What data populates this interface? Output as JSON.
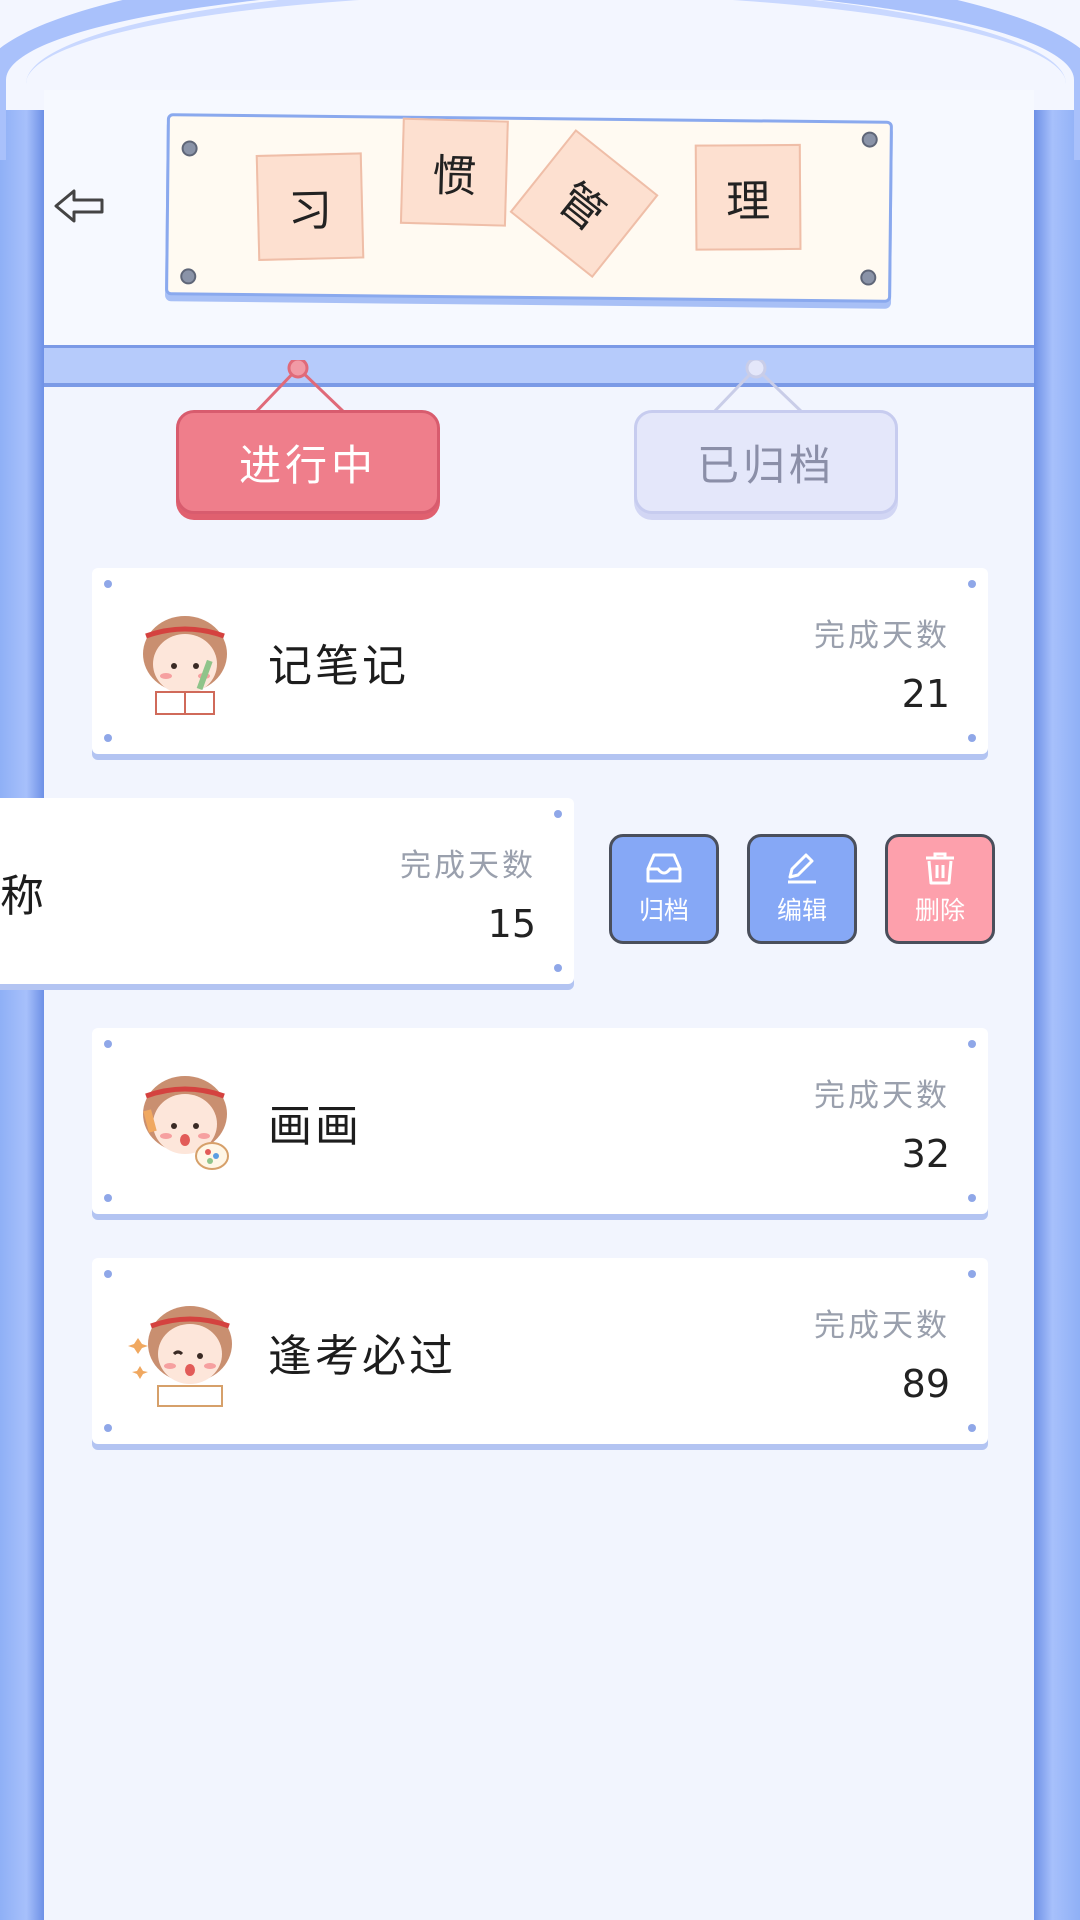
{
  "header": {
    "title_chars": [
      "习",
      "惯",
      "管",
      "理"
    ],
    "back_icon": "back-arrow-icon"
  },
  "tabs": [
    {
      "label": "进行中",
      "active": true
    },
    {
      "label": "已归档",
      "active": false
    }
  ],
  "habits": [
    {
      "name": "记笔记",
      "days_label": "完成天数",
      "days": "21",
      "avatar": "girl-taking-notes"
    },
    {
      "name": "称",
      "days_label": "完成天数",
      "days": "15",
      "swiped": true
    },
    {
      "name": "画画",
      "days_label": "完成天数",
      "days": "32",
      "avatar": "girl-painting"
    },
    {
      "name": "逢考必过",
      "days_label": "完成天数",
      "days": "89",
      "avatar": "girl-exam-luck"
    }
  ],
  "actions": {
    "archive_label": "归档",
    "edit_label": "编辑",
    "delete_label": "删除"
  },
  "colors": {
    "frame_blue": "#a9c1fb",
    "active_tab": "#ef7e8b",
    "action_blue": "#86a8f6",
    "action_pink": "#fda0ac"
  }
}
